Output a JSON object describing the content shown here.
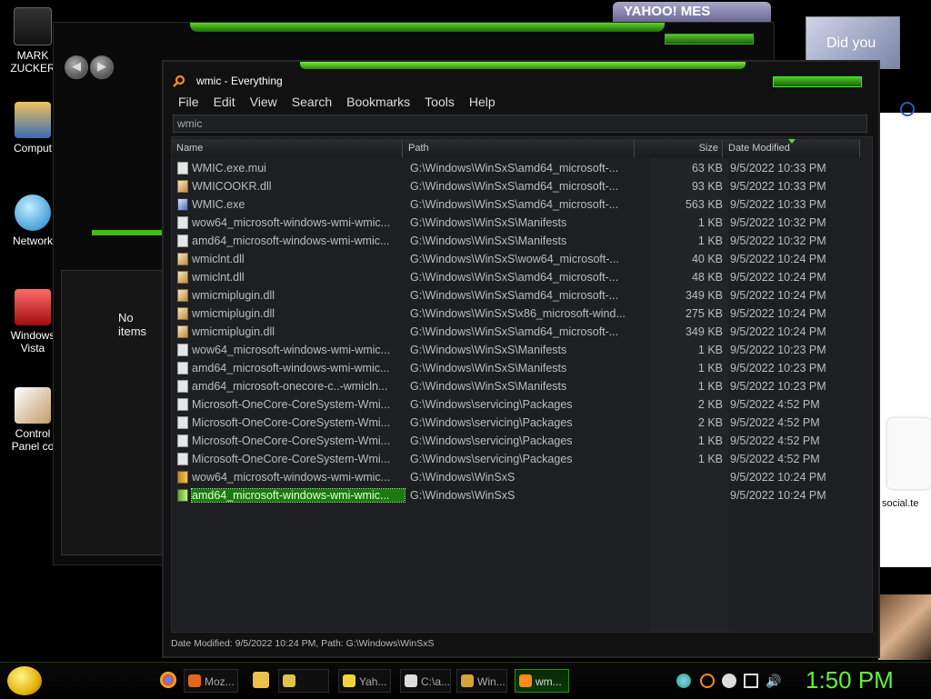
{
  "desktop": {
    "icons": [
      {
        "label": "MARK ZUCKER"
      },
      {
        "label": "Comput"
      },
      {
        "label": "Network"
      },
      {
        "label": "Windows Vista"
      },
      {
        "label": "Control Panel co"
      }
    ]
  },
  "background_window": {
    "empty_text": "No items"
  },
  "yahoo": {
    "tab_label": "YAHOO! MES",
    "avatar_text": "Did you"
  },
  "right_panel": {
    "social_label": "social.te"
  },
  "everything": {
    "title": "wmic - Everything",
    "menu": [
      "File",
      "Edit",
      "View",
      "Search",
      "Bookmarks",
      "Tools",
      "Help"
    ],
    "search_value": "wmic",
    "columns": [
      "Name",
      "Path",
      "Size",
      "Date Modified"
    ],
    "rows": [
      {
        "name": "WMIC.exe.mui",
        "path": "G:\\Windows\\WinSxS\\amd64_microsoft-...",
        "size": "63 KB",
        "date": "9/5/2022 10:33 PM",
        "icon": "file"
      },
      {
        "name": "WMICOOKR.dll",
        "path": "G:\\Windows\\WinSxS\\amd64_microsoft-...",
        "size": "93 KB",
        "date": "9/5/2022 10:33 PM",
        "icon": "dll"
      },
      {
        "name": "WMIC.exe",
        "path": "G:\\Windows\\WinSxS\\amd64_microsoft-...",
        "size": "563 KB",
        "date": "9/5/2022 10:33 PM",
        "icon": "exe"
      },
      {
        "name": "wow64_microsoft-windows-wmi-wmic...",
        "path": "G:\\Windows\\WinSxS\\Manifests",
        "size": "1 KB",
        "date": "9/5/2022 10:32 PM",
        "icon": "file"
      },
      {
        "name": "amd64_microsoft-windows-wmi-wmic...",
        "path": "G:\\Windows\\WinSxS\\Manifests",
        "size": "1 KB",
        "date": "9/5/2022 10:32 PM",
        "icon": "file"
      },
      {
        "name": "wmiclnt.dll",
        "path": "G:\\Windows\\WinSxS\\wow64_microsoft-...",
        "size": "40 KB",
        "date": "9/5/2022 10:24 PM",
        "icon": "dll"
      },
      {
        "name": "wmiclnt.dll",
        "path": "G:\\Windows\\WinSxS\\amd64_microsoft-...",
        "size": "48 KB",
        "date": "9/5/2022 10:24 PM",
        "icon": "dll"
      },
      {
        "name": "wmicmiplugin.dll",
        "path": "G:\\Windows\\WinSxS\\amd64_microsoft-...",
        "size": "349 KB",
        "date": "9/5/2022 10:24 PM",
        "icon": "dll"
      },
      {
        "name": "wmicmiplugin.dll",
        "path": "G:\\Windows\\WinSxS\\x86_microsoft-wind...",
        "size": "275 KB",
        "date": "9/5/2022 10:24 PM",
        "icon": "dll"
      },
      {
        "name": "wmicmiplugin.dll",
        "path": "G:\\Windows\\WinSxS\\amd64_microsoft-...",
        "size": "349 KB",
        "date": "9/5/2022 10:24 PM",
        "icon": "dll"
      },
      {
        "name": "wow64_microsoft-windows-wmi-wmic...",
        "path": "G:\\Windows\\WinSxS\\Manifests",
        "size": "1 KB",
        "date": "9/5/2022 10:23 PM",
        "icon": "file"
      },
      {
        "name": "amd64_microsoft-windows-wmi-wmic...",
        "path": "G:\\Windows\\WinSxS\\Manifests",
        "size": "1 KB",
        "date": "9/5/2022 10:23 PM",
        "icon": "file"
      },
      {
        "name": "amd64_microsoft-onecore-c..-wmicln...",
        "path": "G:\\Windows\\WinSxS\\Manifests",
        "size": "1 KB",
        "date": "9/5/2022 10:23 PM",
        "icon": "file"
      },
      {
        "name": "Microsoft-OneCore-CoreSystem-Wmi...",
        "path": "G:\\Windows\\servicing\\Packages",
        "size": "2 KB",
        "date": "9/5/2022 4:52 PM",
        "icon": "file"
      },
      {
        "name": "Microsoft-OneCore-CoreSystem-Wmi...",
        "path": "G:\\Windows\\servicing\\Packages",
        "size": "2 KB",
        "date": "9/5/2022 4:52 PM",
        "icon": "file"
      },
      {
        "name": "Microsoft-OneCore-CoreSystem-Wmi...",
        "path": "G:\\Windows\\servicing\\Packages",
        "size": "1 KB",
        "date": "9/5/2022 4:52 PM",
        "icon": "file"
      },
      {
        "name": "Microsoft-OneCore-CoreSystem-Wmi...",
        "path": "G:\\Windows\\servicing\\Packages",
        "size": "1 KB",
        "date": "9/5/2022 4:52 PM",
        "icon": "file"
      },
      {
        "name": "wow64_microsoft-windows-wmi-wmic...",
        "path": "G:\\Windows\\WinSxS",
        "size": "",
        "date": "9/5/2022 10:24 PM",
        "icon": "folder"
      },
      {
        "name": "amd64_microsoft-windows-wmi-wmic...",
        "path": "G:\\Windows\\WinSxS",
        "size": "",
        "date": "9/5/2022 10:24 PM",
        "icon": "folder-g",
        "selected": true
      }
    ],
    "status": "Date Modified: 9/5/2022 10:24 PM, Path: G:\\Windows\\WinSxS"
  },
  "taskbar": {
    "buttons": [
      {
        "label": "Moz...",
        "color": "#e5661a"
      },
      {
        "label": "",
        "color": "#e0c24a"
      },
      {
        "label": "Yah...",
        "color": "#f2d43a"
      },
      {
        "label": "C:\\a...",
        "color": "#dddddd"
      },
      {
        "label": "Win...",
        "color": "#d6a23a"
      },
      {
        "label": "wm...",
        "color": "#ff8a1c",
        "active": true
      }
    ],
    "clock": "1:50 PM"
  },
  "colors": {
    "accent_green": "#3fbf10",
    "selection_green": "#1b7a0f",
    "clock_green": "#5ff23a"
  }
}
